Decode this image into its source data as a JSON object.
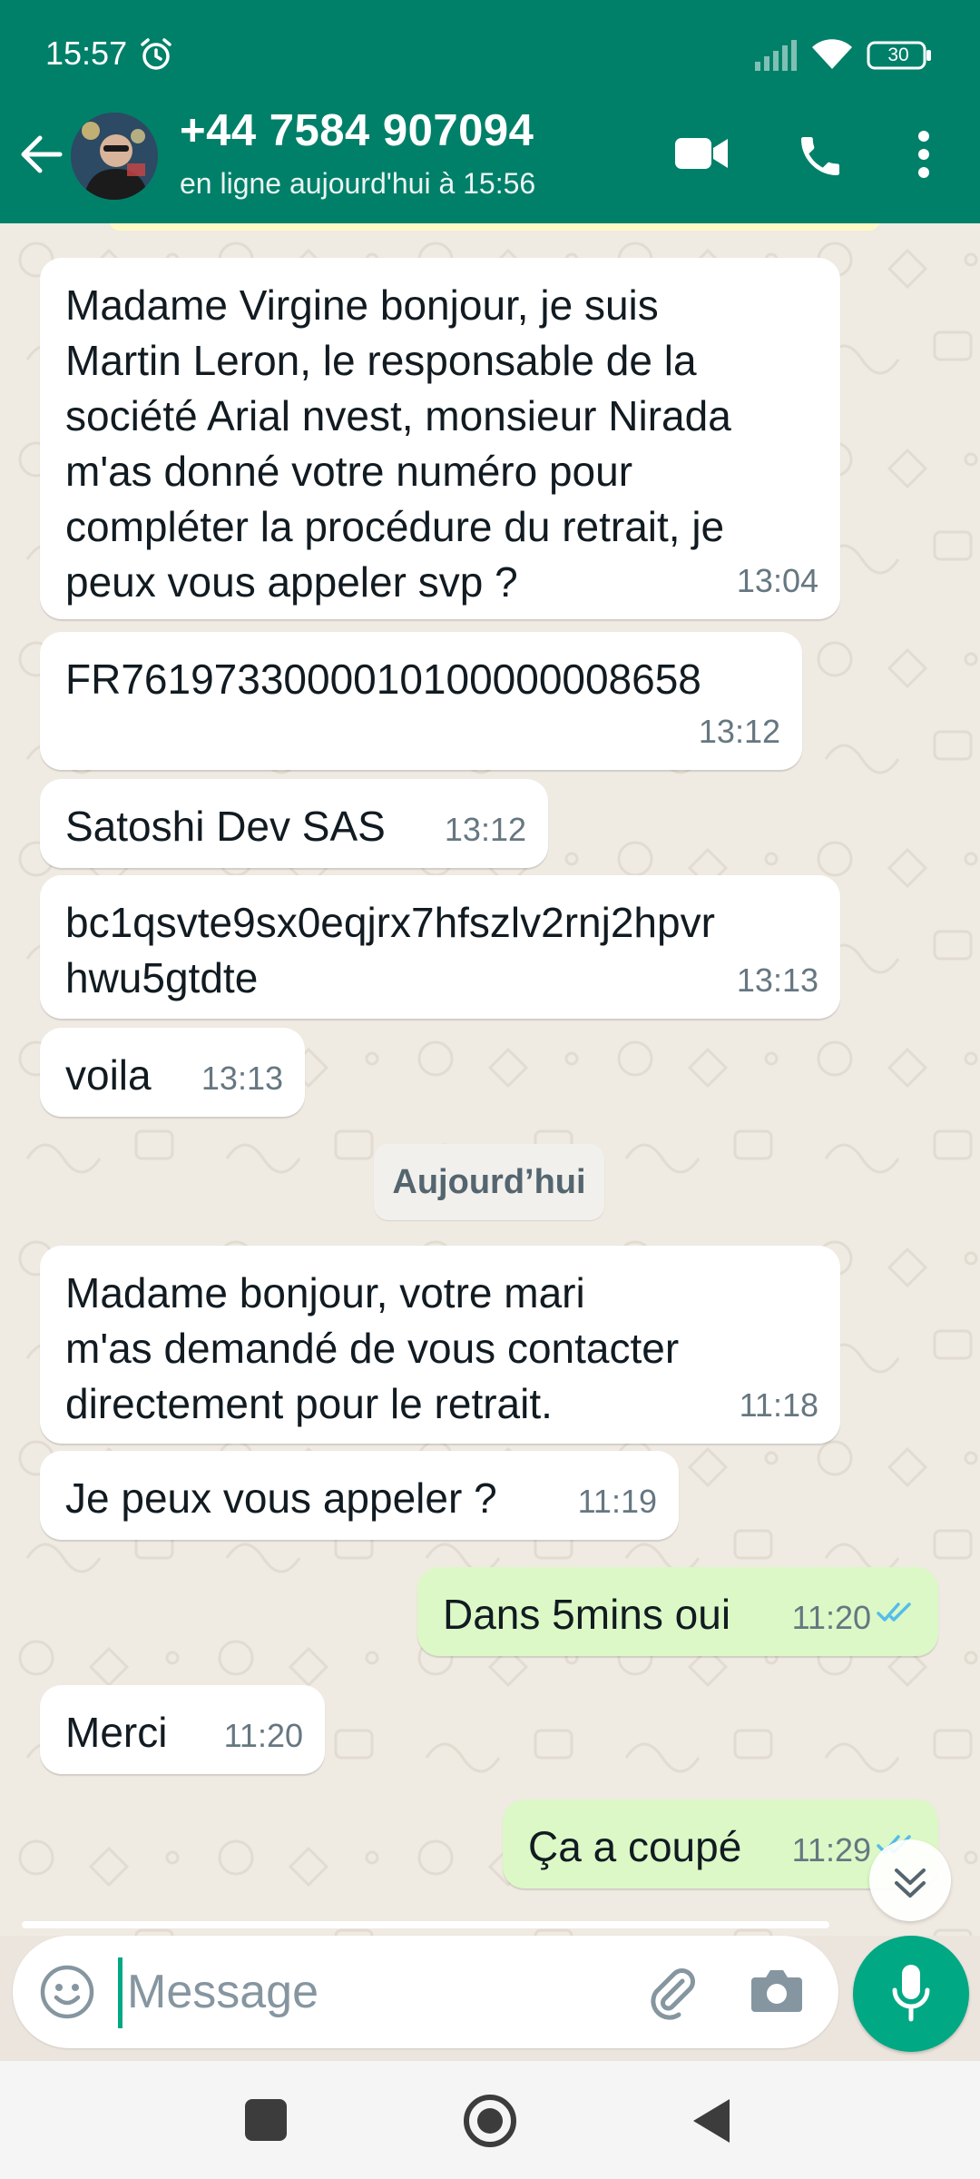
{
  "status_bar": {
    "time": "15:57",
    "battery": "30",
    "icons": [
      "alarm-icon",
      "signal-icon",
      "wifi-icon",
      "battery-icon"
    ]
  },
  "header": {
    "contact_name": "+44 7584 907094",
    "contact_status": "en ligne aujourd'hui à 15:56",
    "icons": [
      "back-arrow-icon",
      "avatar",
      "video-call-icon",
      "voice-call-icon",
      "more-options-icon"
    ]
  },
  "colors": {
    "header": "#008069",
    "chat_background": "#efeae2",
    "incoming_bubble": "#ffffff",
    "outgoing_bubble": "#dcf8c6",
    "accent": "#00a884",
    "read_ticks": "#53bdeb"
  },
  "messages": [
    {
      "direction": "in",
      "text": "Madame Virgine bonjour, je suis\nMartin Leron, le responsable de la\nsociété Arial nvest, monsieur Nirada\nm'as donné votre numéro pour\ncompléter la procédure du retrait, je\npeux vous appeler svp ?",
      "time": "13:04"
    },
    {
      "direction": "in",
      "text": "FR7619733000010100000008658",
      "time": "13:12"
    },
    {
      "direction": "in",
      "text": "Satoshi Dev SAS",
      "time": "13:12"
    },
    {
      "direction": "in",
      "text": "bc1qsvte9sx0eqjrx7hfszlv2rnj2hpvr\nhwu5gtdte",
      "time": "13:13"
    },
    {
      "direction": "in",
      "text": "voila",
      "time": "13:13"
    },
    {
      "direction": "in",
      "text": "Madame bonjour, votre mari\nm'as demandé de vous contacter\ndirectement pour le retrait.",
      "time": "11:18"
    },
    {
      "direction": "in",
      "text": "Je peux vous appeler ?",
      "time": "11:19"
    },
    {
      "direction": "out",
      "text": "Dans 5mins oui",
      "time": "11:20",
      "status": "read"
    },
    {
      "direction": "in",
      "text": "Merci",
      "time": "11:20"
    },
    {
      "direction": "out",
      "text": "Ça a coupé",
      "time": "11:29",
      "status": "read"
    }
  ],
  "date_separator": "Aujourd’hui",
  "composer": {
    "placeholder": "Message",
    "icons": [
      "emoji-icon",
      "attach-icon",
      "camera-icon",
      "mic-icon"
    ]
  },
  "nav": {
    "icons": [
      "recents-icon",
      "home-icon",
      "back-icon"
    ]
  }
}
